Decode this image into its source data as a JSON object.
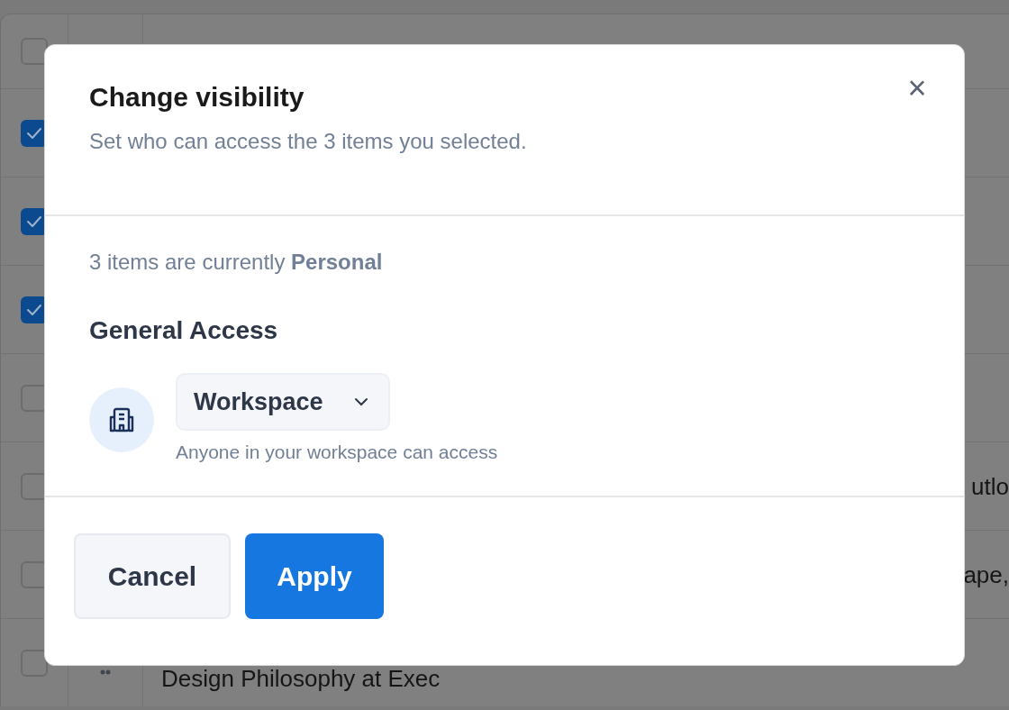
{
  "table": {
    "rows": [
      {
        "checked": false
      },
      {
        "checked": true
      },
      {
        "checked": true
      },
      {
        "checked": true
      },
      {
        "checked": false
      },
      {
        "checked": false,
        "name": "utlo"
      },
      {
        "checked": false,
        "name": "ape,"
      },
      {
        "checked": false,
        "name": "Design Philosophy at Exec",
        "handle": true
      }
    ]
  },
  "dialog": {
    "title": "Change visibility",
    "description": "Set who can access the 3 items you selected.",
    "close": "×",
    "current_status": "3 items are currently **Personal**",
    "section_title": "General Access",
    "access_select": {
      "value": "Workspace",
      "hint": "Anyone in your workspace can access"
    },
    "buttons": [
      {
        "label": "Cancel",
        "kind": "secondary"
      },
      {
        "label": "Apply",
        "kind": "primary"
      }
    ]
  }
}
